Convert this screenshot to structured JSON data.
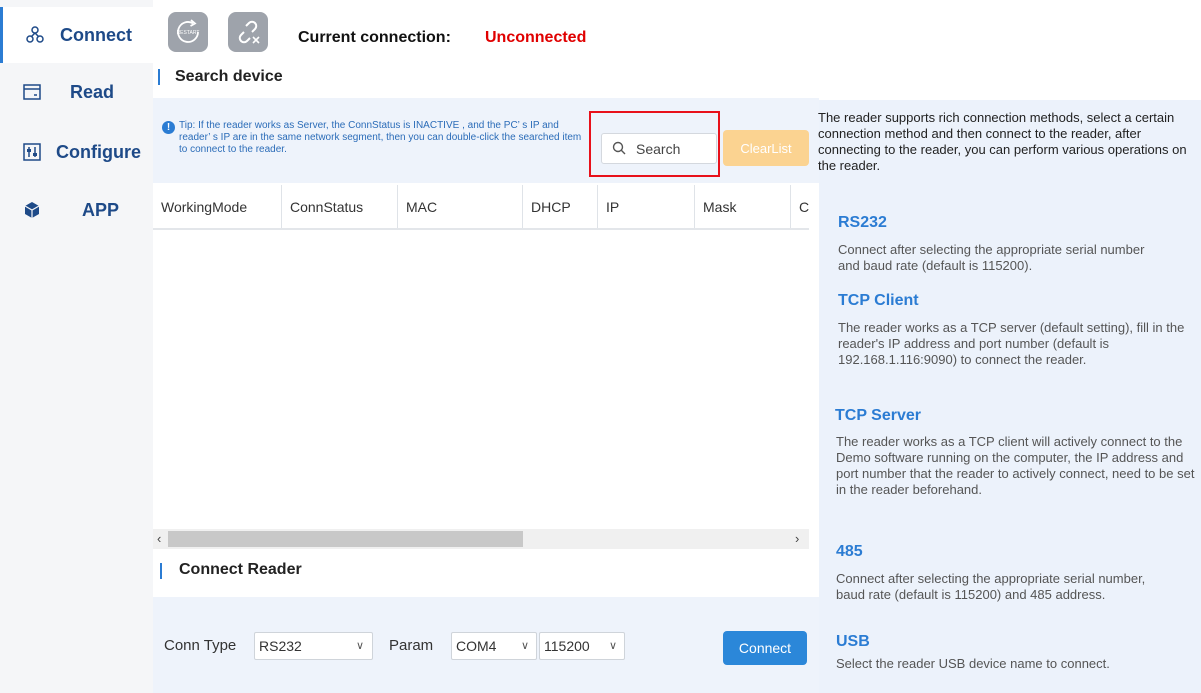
{
  "sidebar": {
    "items": [
      {
        "label": "Connect",
        "icon": "connect-icon"
      },
      {
        "label": "Read",
        "icon": "card-icon"
      },
      {
        "label": "Configure",
        "icon": "settings-box-icon"
      },
      {
        "label": "APP",
        "icon": "cube-icon"
      }
    ]
  },
  "toolbar": {
    "restart_label": "RESTART",
    "connection_label": "Current connection:",
    "connection_status": "Unconnected"
  },
  "search": {
    "title": "Search device",
    "tip": "Tip: If the reader works as Server, the ConnStatus is INACTIVE , and the PC’ s IP and reader’ s IP are in the same network segment, then you can double-click the searched item to connect to the reader.",
    "placeholder": "Search",
    "clear_label": "ClearList"
  },
  "table": {
    "columns": [
      "WorkingMode",
      "ConnStatus",
      "MAC",
      "DHCP",
      "IP",
      "Mask",
      "C"
    ],
    "rows": []
  },
  "connect_reader": {
    "title": "Connect Reader",
    "conn_type_label": "Conn Type",
    "conn_type_value": "RS232",
    "param_label": "Param",
    "port_value": "COM4",
    "baud_value": "115200",
    "connect_label": "Connect"
  },
  "help": {
    "intro": "The reader supports rich connection methods, select a certain connection method and then connect to the reader, after connecting to the reader, you can perform various operations on the reader.",
    "sections": [
      {
        "heading": "RS232",
        "text": "Connect after selecting the appropriate serial number and baud rate (default is 115200)."
      },
      {
        "heading": "TCP Client",
        "text": "The reader works as a TCP server (default setting), fill in the reader's IP address and port number (default is 192.168.1.116:9090) to connect the reader."
      },
      {
        "heading": "TCP Server",
        "text": "The reader works as a TCP client will actively connect to the Demo software running on the computer, the IP address and port number that the reader to actively connect, need  to be set in the reader beforehand."
      },
      {
        "heading": "485",
        "text": "Connect after selecting the appropriate serial number, baud rate (default is 115200) and 485 address."
      },
      {
        "heading": "USB",
        "text": "Select the reader USB device name to connect."
      }
    ]
  },
  "colors": {
    "accent": "#2b7cd3",
    "status_error": "#e00000",
    "clear_button": "#fbd391",
    "connect_button": "#2b87d9",
    "highlight_box": "#e8101a"
  }
}
